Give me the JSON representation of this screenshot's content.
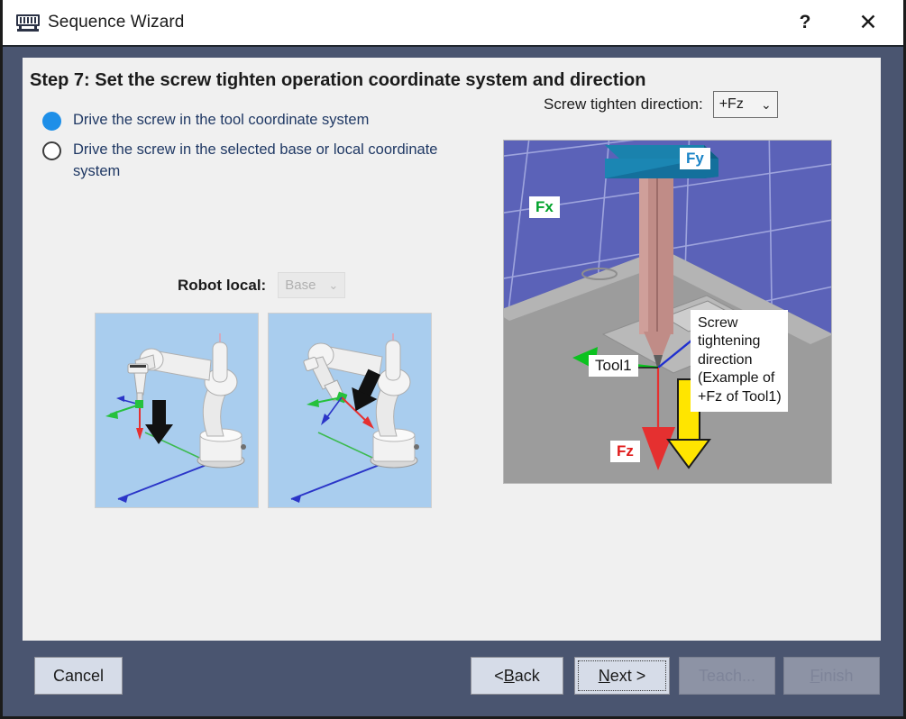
{
  "window": {
    "title": "Sequence Wizard",
    "icon": "chip-icon",
    "help_label": "?",
    "close_label": "✕"
  },
  "step": {
    "heading": "Step 7: Set the screw tighten operation coordinate system and direction"
  },
  "coordinate_options": {
    "items": [
      {
        "label": "Drive the screw in the tool coordinate system",
        "selected": true
      },
      {
        "label": "Drive the screw in the selected base or local coordinate system",
        "selected": false
      }
    ]
  },
  "robot_local": {
    "label": "Robot local:",
    "value": "Base",
    "enabled": false,
    "chevron": "⌄"
  },
  "screw_direction": {
    "label": "Screw tighten direction:",
    "value": "+Fz",
    "chevron": "⌄"
  },
  "scene": {
    "labels": {
      "fx": "Fx",
      "fy": "Fy",
      "fz": "Fz",
      "tool": "Tool1"
    },
    "callout": [
      "Screw",
      "tightening",
      "direction",
      "(Example of",
      "+Fz of Tool1)"
    ],
    "colors": {
      "fx": "#00a22a",
      "fy": "#1a84c7",
      "fz": "#e01b1b",
      "arrow": "#ffe500",
      "grid": "#5b62b8",
      "tool_shaft": "#c08c87",
      "tool_head": "#0e6a96",
      "plate": "#9c9c9c"
    }
  },
  "robot_previews": [
    {
      "name": "tool-coordinate-down-arrow",
      "background": "#a9cdee"
    },
    {
      "name": "base-coordinate-angled-arrow",
      "background": "#a9cdee"
    }
  ],
  "footer": {
    "cancel": "Cancel",
    "back_prefix": "< ",
    "back_underline": "B",
    "back_suffix": "ack",
    "next_underline": "N",
    "next_suffix": "ext >",
    "teach": "Teach...",
    "finish_underline": "F",
    "finish_suffix": "inish"
  }
}
